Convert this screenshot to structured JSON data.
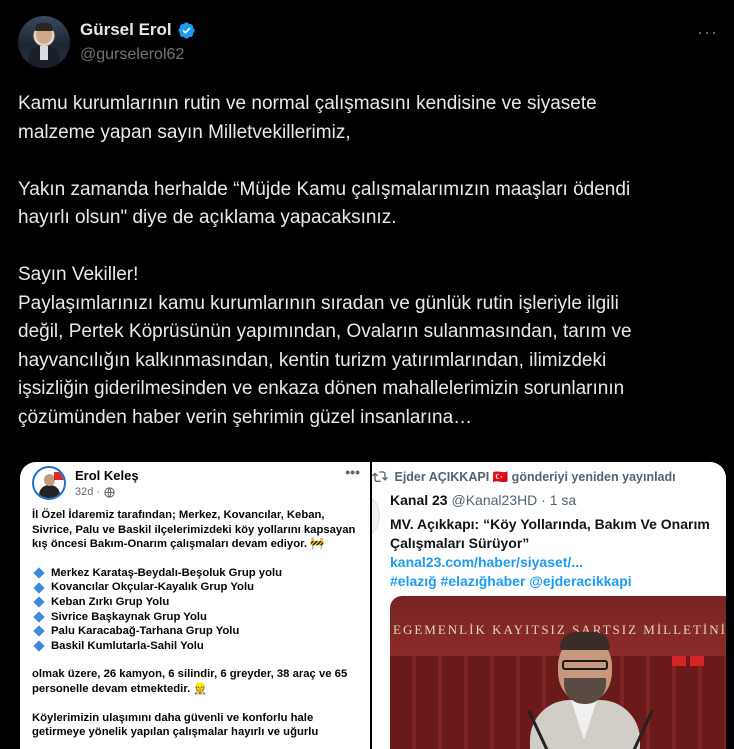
{
  "author": {
    "display_name": "Gürsel Erol",
    "handle": "@gurselerol62",
    "verified": true,
    "more_label": "···"
  },
  "tweet": {
    "text": "Kamu kurumlarının rutin ve normal çalışmasını kendisine ve siyasete\nmalzeme yapan sayın Milletvekillerimiz,\n\nYakın zamanda herhalde “Müjde Kamu çalışmalarımızın maaşları ödendi\nhayırlı olsun\" diye de açıklama yapacaksınız.\n\nSayın Vekiller!\nPaylaşımlarınızı kamu kurumlarının sıradan ve günlük rutin işleriyle ilgili\ndeğil, Pertek Köprüsünün yapımından, Ovaların sulanmasından, tarım ve\nhayvancılığın kalkınmasından, kentin turizm yatırımlarından, ilimizdeki\nişsizliğin giderilmesinden ve enkaza dönen mahallelerimizin sorunlarının\nçözümünden haber verin şehrimin güzel insanlarına…"
  },
  "media_left": {
    "name": "Erol Keleş",
    "time": "32d ·",
    "dots": "•••",
    "intro": "İl Özel İdaremiz tarafından; Merkez, Kovancılar, Keban, Sivrice, Palu ve Baskil ilçelerimizdeki köy yollarını kapsayan kış öncesi Bakım-Onarım çalışmaları devam ediyor. 🚧",
    "items": [
      "Merkez Karataş-Beydalı-Beşoluk Grup yolu",
      "Kovancılar Okçular-Kayalık Grup Yolu",
      "Keban Zırkı Grup Yolu",
      "Sivrice Başkaynak Grup Yolu",
      "Palu Karacabağ-Tarhana Grup Yolu",
      "Baskil Kumlutarla-Sahil Yolu"
    ],
    "stats": "olmak üzere, 26 kamyon, 6 silindir, 6 greyder, 38 araç ve 65 personelle devam etmektedir. 👷",
    "closing": "Köylerimizin ulaşımını daha güvenli ve konforlu hale getirmeye yönelik yapılan çalışmalar hayırlı ve uğurlu"
  },
  "media_right": {
    "retweet_line": "Ejder AÇIKKAPI 🇹🇷 gönderiyi yeniden yayınladı",
    "channel_name": "Kanal 23",
    "channel_meta": "@Kanal23HD · 1 sa",
    "title": "MV. Açıkkapı: “Köy Yollarında, Bakım Ve Onarım Çalışmaları Sürüyor”",
    "link": "kanal23.com/haber/siyaset/...",
    "hashtags": "#elazığ #elazığhaber @ejderacikkapi",
    "photo_banner": "EGEMENLİK KAYITSIZ ŞARTSIZ MİLLETİNİ"
  },
  "colors": {
    "background": "#000000",
    "text": "#e7e9ea",
    "muted": "#71767b",
    "link_blue": "#1d9bf0",
    "verified_blue": "#1d9bf0"
  }
}
